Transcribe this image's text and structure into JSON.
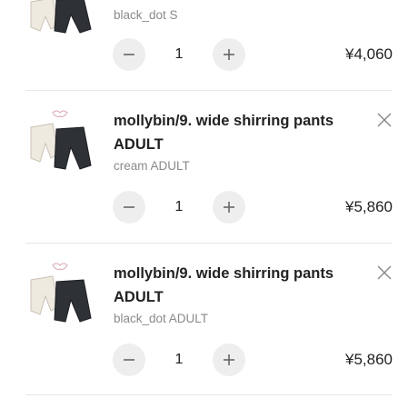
{
  "items": [
    {
      "variant": "black_dot S",
      "quantity": "1",
      "price": "¥4,060",
      "image_icon": "shirring-pants-product-icon"
    },
    {
      "name": "mollybin/9. wide shirring pants ADULT",
      "variant": "cream ADULT",
      "quantity": "1",
      "price": "¥5,860",
      "image_icon": "shirring-pants-product-icon"
    },
    {
      "name": "mollybin/9. wide shirring pants ADULT",
      "variant": "black_dot ADULT",
      "quantity": "1",
      "price": "¥5,860",
      "image_icon": "shirring-pants-product-icon"
    }
  ],
  "icons": {
    "decrement": "minus-icon",
    "increment": "plus-icon",
    "remove": "close-icon"
  },
  "colors": {
    "stepper_bg": "#eeeeee",
    "divider": "#e6e6e6",
    "variant_text": "#8a8a8a"
  }
}
